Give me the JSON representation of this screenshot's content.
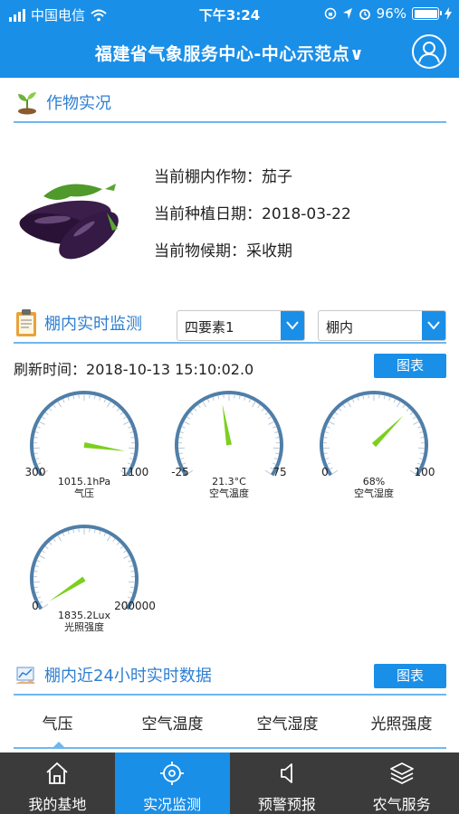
{
  "status_bar": {
    "carrier": "中国电信",
    "time": "下午3:24",
    "battery": "96%"
  },
  "header": {
    "title": "福建省气象服务中心-中心示范点∨"
  },
  "crop_section": {
    "title": "作物实况",
    "crop_label": "当前棚内作物：",
    "crop_value": "茄子",
    "plant_date_label": "当前种植日期：",
    "plant_date_value": "2018-03-22",
    "phenology_label": "当前物候期：",
    "phenology_value": "采收期"
  },
  "monitor_section": {
    "title": "棚内实时监测",
    "select_element": "四要素1",
    "select_location": "棚内",
    "refresh_label": "刷新时间：",
    "refresh_time": "2018-10-13 15:10:02.0",
    "chart_button": "图表"
  },
  "gauges": [
    {
      "name": "气压",
      "min_label": "300",
      "max_label": "1100",
      "min": 300,
      "max": 1100,
      "value": 1015.1,
      "value_text": "1015.1hPa"
    },
    {
      "name": "空气温度",
      "min_label": "-25",
      "max_label": "75",
      "min": -25,
      "max": 75,
      "value": 21.3,
      "value_text": "21.3°C"
    },
    {
      "name": "空气湿度",
      "min_label": "0",
      "max_label": "100",
      "min": 0,
      "max": 100,
      "value": 68,
      "value_text": "68%"
    },
    {
      "name": "光照强度",
      "min_label": "0",
      "max_label": "200000",
      "min": 0,
      "max": 200000,
      "value": 1835.2,
      "value_text": "1835.2Lux"
    }
  ],
  "history_section": {
    "title": "棚内近24小时实时数据",
    "chart_button": "图表",
    "tabs": [
      "气压",
      "空气温度",
      "空气湿度",
      "光照强度"
    ],
    "active_tab": 0
  },
  "bottom_nav": {
    "items": [
      "我的基地",
      "实况监测",
      "预警预报",
      "农气服务"
    ],
    "active": 1
  },
  "colors": {
    "primary": "#1a8fe8",
    "gauge_arc": "#4f7fa8",
    "needle": "#7ccf1f",
    "nav_bg": "#3b3b3b"
  }
}
